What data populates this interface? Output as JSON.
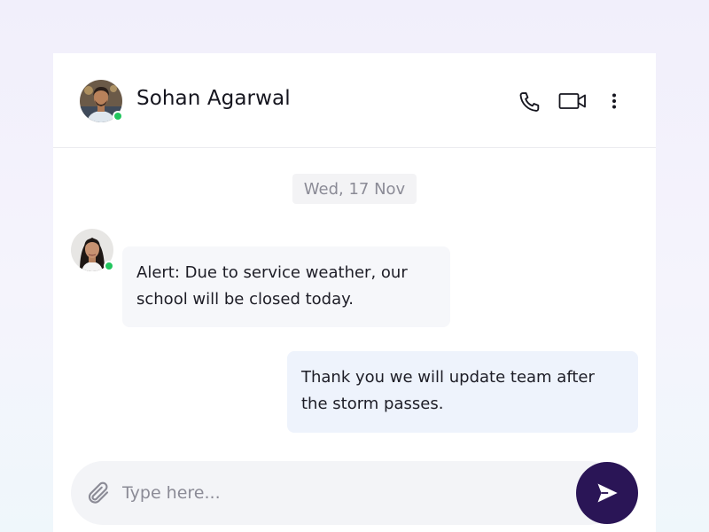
{
  "contact": {
    "name": "Sohan Agarwal",
    "status": "online"
  },
  "header_actions": {
    "call_icon": "phone-icon",
    "video_icon": "video-camera-icon",
    "more_icon": "more-vertical-icon"
  },
  "conversation": {
    "date_separator": "Wed, 17 Nov",
    "messages": [
      {
        "direction": "incoming",
        "lines": [
          "Alert: Due to service weather, our",
          "school will be closed today."
        ],
        "sender_status": "online"
      },
      {
        "direction": "outgoing",
        "lines": [
          "Thank you we will update team after",
          "the storm passes."
        ]
      }
    ]
  },
  "composer": {
    "placeholder": "Type here...",
    "value": "",
    "attach_icon": "paperclip-icon",
    "send_icon": "send-icon"
  },
  "colors": {
    "send_button": "#2a1556",
    "online": "#22c55e",
    "incoming_bubble": "#f6f7fa",
    "outgoing_bubble": "#eef3fc"
  }
}
